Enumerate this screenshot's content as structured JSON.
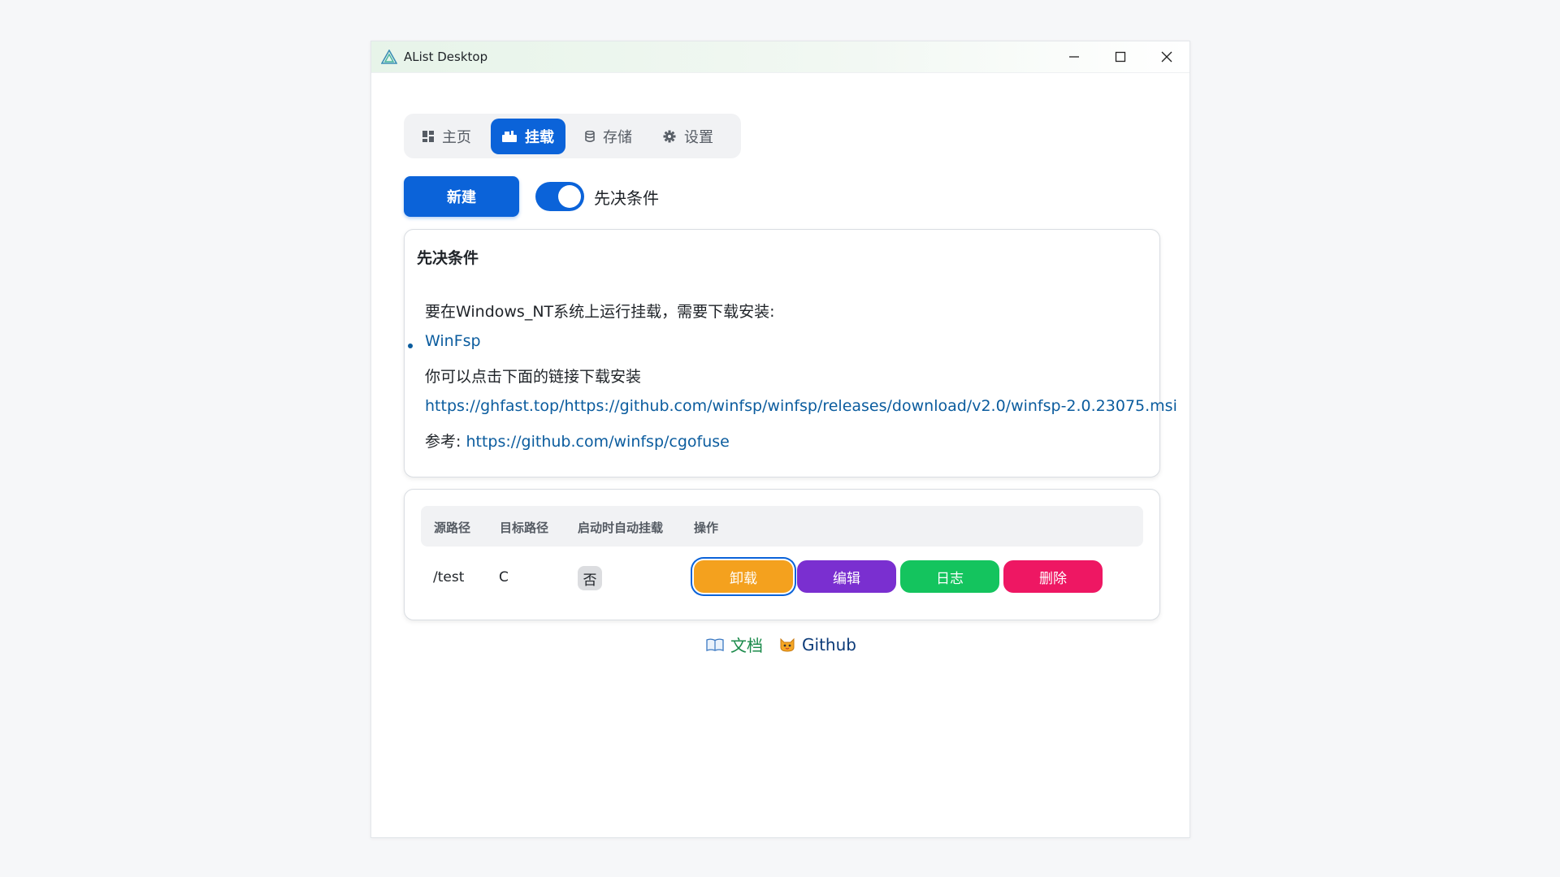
{
  "window": {
    "title": "AList Desktop"
  },
  "tabs": [
    {
      "label": "主页",
      "icon": "dashboard-icon",
      "active": false
    },
    {
      "label": "挂载",
      "icon": "mount-icon",
      "active": true
    },
    {
      "label": "存储",
      "icon": "database-icon",
      "active": false
    },
    {
      "label": "设置",
      "icon": "gear-icon",
      "active": false
    }
  ],
  "actions": {
    "new_label": "新建",
    "toggle_label": "先决条件",
    "toggle_on": true
  },
  "prereq": {
    "title": "先决条件",
    "intro": "要在Windows_NT系统上运行挂载，需要下载安装:",
    "item": "WinFsp",
    "hint": "你可以点击下面的链接下载安装",
    "download_url": "https://ghfast.top/https://github.com/winfsp/winfsp/releases/download/v2.0/winfsp-2.0.23075.msi",
    "ref_label": "参考:",
    "ref_url": "https://github.com/winfsp/cgofuse"
  },
  "table": {
    "headers": [
      "源路径",
      "目标路径",
      "启动时自动挂载",
      "操作"
    ],
    "rows": [
      {
        "source": "/test",
        "target": "C",
        "auto_mount": "否"
      }
    ],
    "actions": [
      {
        "label": "卸载",
        "color": "#f4a11e"
      },
      {
        "label": "编辑",
        "color": "#7a2fd0"
      },
      {
        "label": "日志",
        "color": "#14c45e"
      },
      {
        "label": "删除",
        "color": "#ee1763"
      }
    ]
  },
  "footer": {
    "docs_label": "文档",
    "github_label": "Github"
  },
  "colors": {
    "accent": "#0b63d9",
    "link": "#0b5c9e"
  }
}
